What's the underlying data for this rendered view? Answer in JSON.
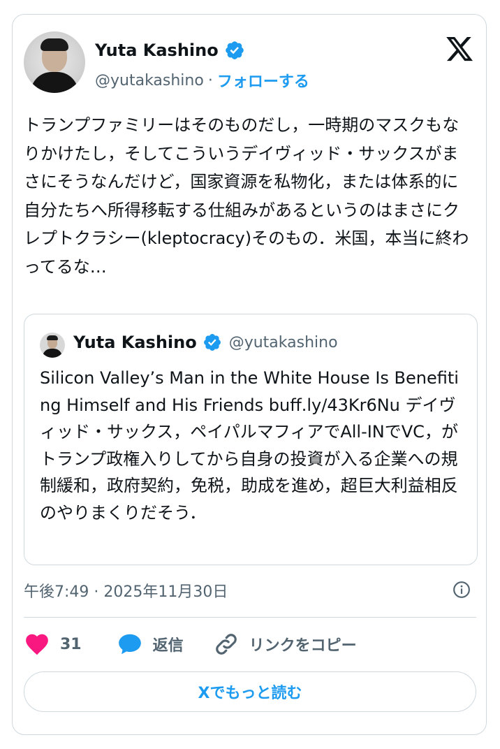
{
  "author": {
    "name": "Yuta Kashino",
    "handle": "@yutakashino",
    "separator": "·",
    "follow_label": "フォローする"
  },
  "icons": {
    "verified": "verified-badge-icon",
    "x_logo": "x-logo-icon",
    "info": "info-icon",
    "like": "heart-icon",
    "reply": "speech-bubble-icon",
    "link": "link-icon"
  },
  "tweet": {
    "text": "トランプファミリーはそのものだし，一時期のマスクもなりかけたし，そしてこういうデイヴィッド・サックスがまさにそうなんだけど，国家資源を私物化，または体系的に自分たちへ所得移転する仕組みがあるというのはまさにクレプトクラシー(kleptocracy)そのもの．米国，本当に終わってるな…",
    "timestamp": "午後7:49 · 2025年11月30日"
  },
  "quote": {
    "name": "Yuta Kashino",
    "handle": "@yutakashino",
    "text": "Silicon Valley’s Man in the White House Is Benefiting Himself and His Friends buff.ly/43Kr6Nu デイヴィッド・サックス，ペイパルマフィアでAll-INでVC，がトランプ政権入りしてから自身の投資が入る企業への規制緩和，政府契約，免税，助成を進め，超巨大利益相反のやりまくりだそう．"
  },
  "actions": {
    "like_count": "31",
    "reply_label": "返信",
    "copy_link_label": "リンクをコピー"
  },
  "read_more_label": "Xでもっと読む",
  "colors": {
    "accent": "#1d9bf0",
    "like": "#f91880",
    "text": "#0f1419",
    "secondary": "#536471",
    "border": "#cfd9de"
  }
}
